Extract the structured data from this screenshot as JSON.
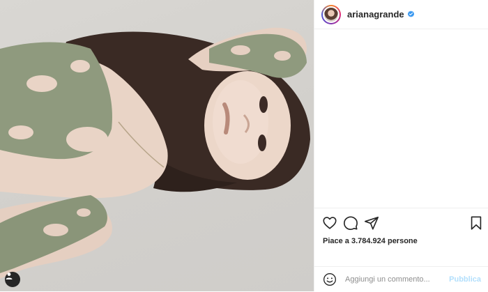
{
  "post": {
    "username": "arianagrande",
    "verified": true,
    "image_alt": "Post photo",
    "likes_text": "Piace a 3.784.924 persone",
    "comment_placeholder": "Aggiungi un commento...",
    "publish_label": "Pubblica"
  },
  "icons": {
    "like": "heart-icon",
    "comment": "comment-icon",
    "share": "share-icon",
    "save": "bookmark-icon",
    "emoji": "emoji-icon",
    "user_tag": "user-tag-icon",
    "verified": "verified-badge-icon"
  },
  "colors": {
    "text": "#262626",
    "muted": "#8e8e8e",
    "border": "#efefef",
    "verified_blue": "#3897f0",
    "publish_disabled": "#b2dffc",
    "outfit_green": "#8f9a7e"
  }
}
